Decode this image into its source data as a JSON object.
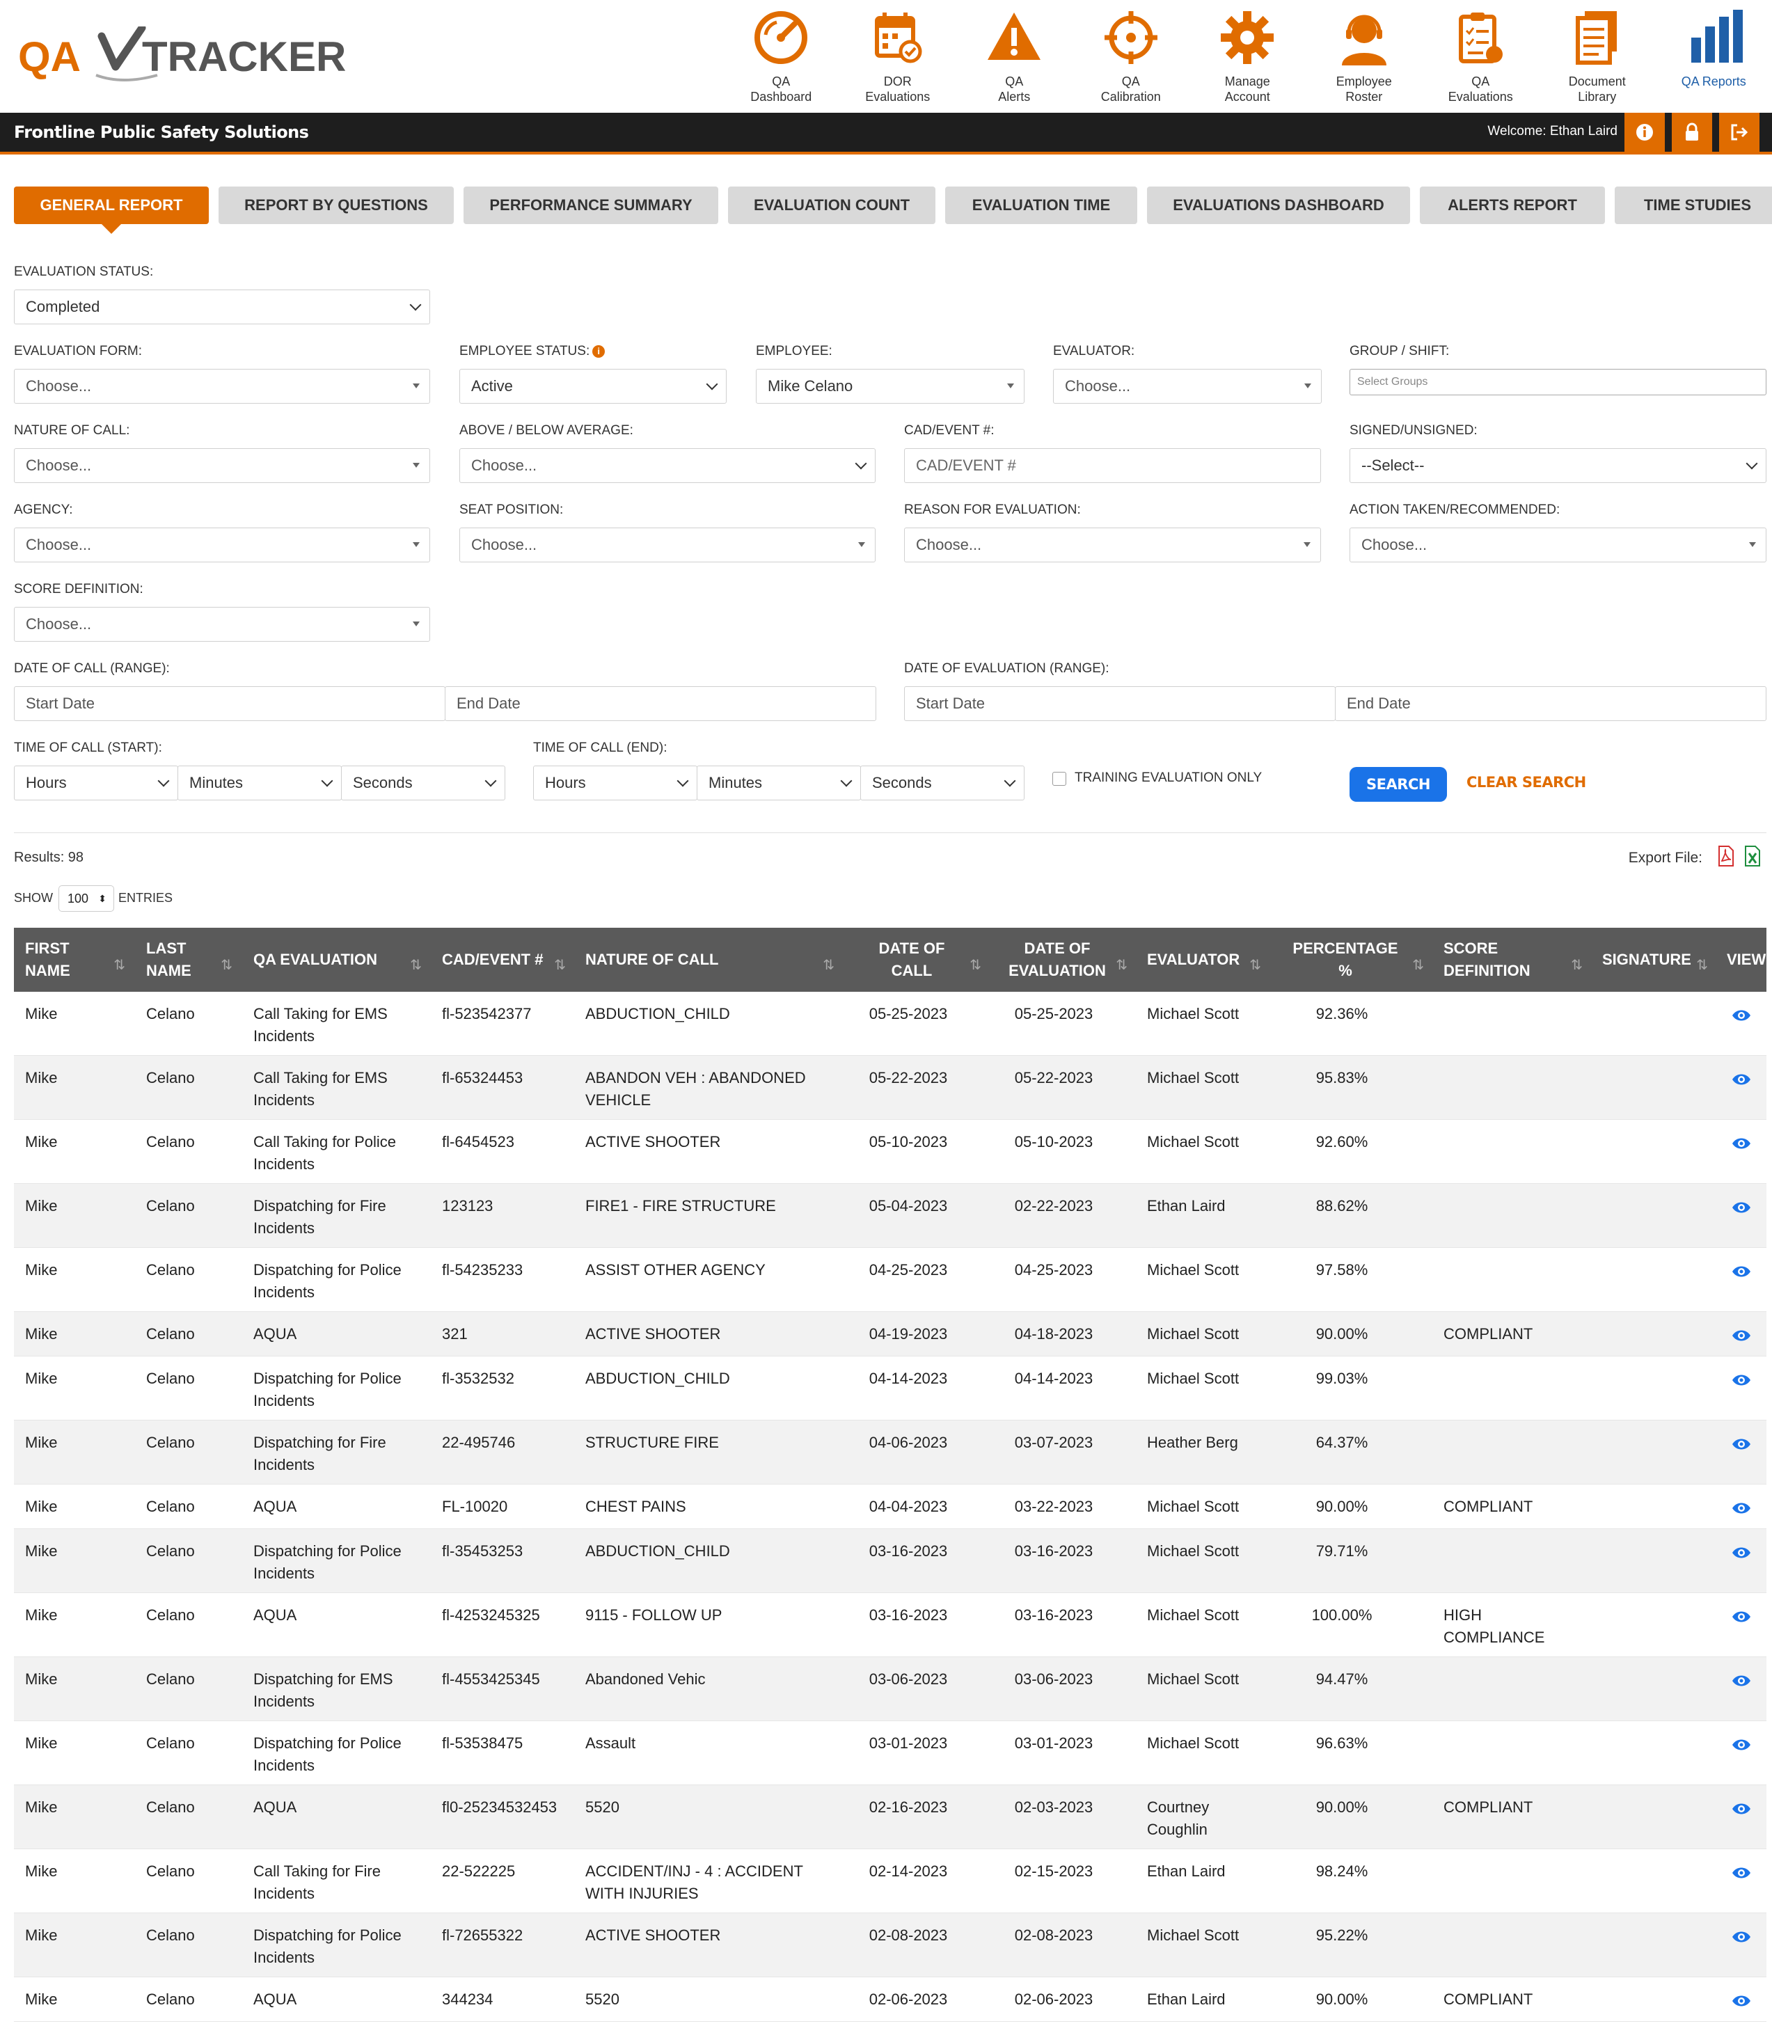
{
  "brand": {
    "logo_text_left": "QA",
    "logo_text_right": "TRACKER"
  },
  "nav": [
    {
      "label_line1": "QA",
      "label_line2": "Dashboard",
      "icon": "speedometer-icon"
    },
    {
      "label_line1": "DOR",
      "label_line2": "Evaluations",
      "icon": "calendar-check-icon"
    },
    {
      "label_line1": "QA",
      "label_line2": "Alerts",
      "icon": "warning-icon"
    },
    {
      "label_line1": "QA",
      "label_line2": "Calibration",
      "icon": "crosshair-icon"
    },
    {
      "label_line1": "Manage",
      "label_line2": "Account",
      "icon": "gear-icon"
    },
    {
      "label_line1": "Employee",
      "label_line2": "Roster",
      "icon": "headset-user-icon"
    },
    {
      "label_line1": "QA",
      "label_line2": "Evaluations",
      "icon": "clipboard-icon"
    },
    {
      "label_line1": "Document",
      "label_line2": "Library",
      "icon": "documents-icon"
    },
    {
      "label_line1": "QA Reports",
      "label_line2": "",
      "icon": "bar-chart-icon"
    }
  ],
  "topbar": {
    "org": "Frontline Public Safety Solutions",
    "welcome": "Welcome: Ethan Laird"
  },
  "tabs": [
    "GENERAL REPORT",
    "REPORT BY QUESTIONS",
    "PERFORMANCE SUMMARY",
    "EVALUATION COUNT",
    "EVALUATION TIME",
    "EVALUATIONS DASHBOARD",
    "ALERTS REPORT",
    "TIME STUDIES"
  ],
  "filters": {
    "evaluation_status": {
      "label": "EVALUATION STATUS:",
      "value": "Completed"
    },
    "evaluation_form": {
      "label": "EVALUATION FORM:",
      "value": "Choose..."
    },
    "employee_status": {
      "label": "EMPLOYEE STATUS:",
      "value": "Active"
    },
    "employee": {
      "label": "EMPLOYEE:",
      "value": "Mike Celano"
    },
    "evaluator": {
      "label": "EVALUATOR:",
      "value": "Choose..."
    },
    "group_shift": {
      "label": "GROUP / SHIFT:",
      "placeholder": "Select Groups"
    },
    "nature_of_call": {
      "label": "NATURE OF CALL:",
      "value": "Choose..."
    },
    "above_below": {
      "label": "ABOVE / BELOW AVERAGE:",
      "value": "Choose..."
    },
    "cad_event": {
      "label": "CAD/EVENT #:",
      "placeholder": "CAD/EVENT #"
    },
    "signed_unsigned": {
      "label": "SIGNED/UNSIGNED:",
      "value": "--Select--"
    },
    "agency": {
      "label": "AGENCY:",
      "value": "Choose..."
    },
    "seat_position": {
      "label": "SEAT POSITION:",
      "value": "Choose..."
    },
    "reason": {
      "label": "REASON FOR EVALUATION:",
      "value": "Choose..."
    },
    "action_taken": {
      "label": "ACTION TAKEN/RECOMMENDED:",
      "value": "Choose..."
    },
    "score_definition": {
      "label": "SCORE DEFINITION:",
      "value": "Choose..."
    },
    "date_of_call": {
      "label": "DATE OF CALL (RANGE):",
      "start": "Start Date",
      "end": "End Date"
    },
    "date_of_eval": {
      "label": "DATE OF EVALUATION (RANGE):",
      "start": "Start Date",
      "end": "End Date"
    },
    "time_start": {
      "label": "TIME OF CALL (START):",
      "hours": "Hours",
      "minutes": "Minutes",
      "seconds": "Seconds"
    },
    "time_end": {
      "label": "TIME OF CALL (END):",
      "hours": "Hours",
      "minutes": "Minutes",
      "seconds": "Seconds"
    },
    "training_only": "TRAINING EVALUATION ONLY",
    "search": "SEARCH",
    "clear": "CLEAR SEARCH"
  },
  "results": {
    "text": "Results: 98",
    "export_label": "Export File:",
    "show": "SHOW",
    "entries_value": "100",
    "entries": "ENTRIES"
  },
  "table": {
    "columns": [
      {
        "l1": "FIRST",
        "l2": "NAME"
      },
      {
        "l1": "LAST",
        "l2": "NAME"
      },
      {
        "l1": "",
        "l2": "QA EVALUATION"
      },
      {
        "l1": "",
        "l2": "CAD/EVENT #"
      },
      {
        "l1": "",
        "l2": "NATURE OF CALL"
      },
      {
        "l1": "DATE OF",
        "l2": "CALL"
      },
      {
        "l1": "DATE OF",
        "l2": "EVALUATION"
      },
      {
        "l1": "",
        "l2": "EVALUATOR"
      },
      {
        "l1": "PERCENTAGE",
        "l2": "%"
      },
      {
        "l1": "SCORE",
        "l2": "DEFINITION"
      },
      {
        "l1": "",
        "l2": "SIGNATURE"
      },
      {
        "l1": "",
        "l2": "VIEW"
      }
    ],
    "rows": [
      [
        "Mike",
        "Celano",
        "Call Taking for EMS Incidents",
        "fl-523542377",
        "ABDUCTION_CHILD",
        "05-25-2023",
        "05-25-2023",
        "Michael Scott",
        "92.36%",
        ""
      ],
      [
        "Mike",
        "Celano",
        "Call Taking for EMS Incidents",
        "fl-65324453",
        "ABANDON VEH : ABANDONED VEHICLE",
        "05-22-2023",
        "05-22-2023",
        "Michael Scott",
        "95.83%",
        ""
      ],
      [
        "Mike",
        "Celano",
        "Call Taking for Police Incidents",
        "fl-6454523",
        "ACTIVE SHOOTER",
        "05-10-2023",
        "05-10-2023",
        "Michael Scott",
        "92.60%",
        ""
      ],
      [
        "Mike",
        "Celano",
        "Dispatching for Fire Incidents",
        "123123",
        "FIRE1 - FIRE STRUCTURE",
        "05-04-2023",
        "02-22-2023",
        "Ethan Laird",
        "88.62%",
        ""
      ],
      [
        "Mike",
        "Celano",
        "Dispatching for Police Incidents",
        "fl-54235233",
        "ASSIST OTHER AGENCY",
        "04-25-2023",
        "04-25-2023",
        "Michael Scott",
        "97.58%",
        ""
      ],
      [
        "Mike",
        "Celano",
        "AQUA",
        "321",
        "ACTIVE SHOOTER",
        "04-19-2023",
        "04-18-2023",
        "Michael Scott",
        "90.00%",
        "COMPLIANT"
      ],
      [
        "Mike",
        "Celano",
        "Dispatching for Police Incidents",
        "fl-3532532",
        "ABDUCTION_CHILD",
        "04-14-2023",
        "04-14-2023",
        "Michael Scott",
        "99.03%",
        ""
      ],
      [
        "Mike",
        "Celano",
        "Dispatching for Fire Incidents",
        "22-495746",
        "STRUCTURE FIRE",
        "04-06-2023",
        "03-07-2023",
        "Heather Berg",
        "64.37%",
        ""
      ],
      [
        "Mike",
        "Celano",
        "AQUA",
        "FL-10020",
        "CHEST PAINS",
        "04-04-2023",
        "03-22-2023",
        "Michael Scott",
        "90.00%",
        "COMPLIANT"
      ],
      [
        "Mike",
        "Celano",
        "Dispatching for Police Incidents",
        "fl-35453253",
        "ABDUCTION_CHILD",
        "03-16-2023",
        "03-16-2023",
        "Michael Scott",
        "79.71%",
        ""
      ],
      [
        "Mike",
        "Celano",
        "AQUA",
        "fl-4253245325",
        "9115 - FOLLOW UP",
        "03-16-2023",
        "03-16-2023",
        "Michael Scott",
        "100.00%",
        "HIGH COMPLIANCE"
      ],
      [
        "Mike",
        "Celano",
        "Dispatching for EMS Incidents",
        "fl-4553425345",
        "Abandoned Vehic",
        "03-06-2023",
        "03-06-2023",
        "Michael Scott",
        "94.47%",
        ""
      ],
      [
        "Mike",
        "Celano",
        "Dispatching for Police Incidents",
        "fl-53538475",
        "Assault",
        "03-01-2023",
        "03-01-2023",
        "Michael Scott",
        "96.63%",
        ""
      ],
      [
        "Mike",
        "Celano",
        "AQUA",
        "fl0-25234532453",
        "5520",
        "02-16-2023",
        "02-03-2023",
        "Courtney Coughlin",
        "90.00%",
        "COMPLIANT"
      ],
      [
        "Mike",
        "Celano",
        "Call Taking for Fire Incidents",
        "22-522225",
        "ACCIDENT/INJ - 4 : ACCIDENT WITH INJURIES",
        "02-14-2023",
        "02-15-2023",
        "Ethan Laird",
        "98.24%",
        ""
      ],
      [
        "Mike",
        "Celano",
        "Dispatching for Police Incidents",
        "fl-72655322",
        "ACTIVE SHOOTER",
        "02-08-2023",
        "02-08-2023",
        "Michael Scott",
        "95.22%",
        ""
      ],
      [
        "Mike",
        "Celano",
        "AQUA",
        "344234",
        "5520",
        "02-06-2023",
        "02-06-2023",
        "Ethan Laird",
        "90.00%",
        "COMPLIANT"
      ]
    ]
  },
  "colors": {
    "accent": "#e06c00",
    "primary_blue": "#1a73e8",
    "header_gray": "#5a5a5a",
    "topbar": "#1e1e1e"
  }
}
